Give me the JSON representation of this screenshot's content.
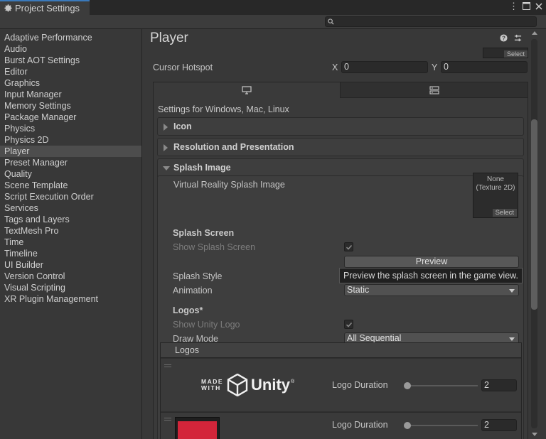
{
  "window": {
    "tab_title": "Project Settings",
    "buttons": [
      "more-options",
      "maximize",
      "close"
    ]
  },
  "search": {
    "placeholder": "",
    "value": ""
  },
  "sidebar": {
    "items": [
      {
        "label": "Adaptive Performance"
      },
      {
        "label": "Audio"
      },
      {
        "label": "Burst AOT Settings"
      },
      {
        "label": "Editor"
      },
      {
        "label": "Graphics"
      },
      {
        "label": "Input Manager"
      },
      {
        "label": "Memory Settings"
      },
      {
        "label": "Package Manager"
      },
      {
        "label": "Physics"
      },
      {
        "label": "Physics 2D"
      },
      {
        "label": "Player",
        "active": true
      },
      {
        "label": "Preset Manager"
      },
      {
        "label": "Quality"
      },
      {
        "label": "Scene Template"
      },
      {
        "label": "Script Execution Order"
      },
      {
        "label": "Services"
      },
      {
        "label": "Tags and Layers"
      },
      {
        "label": "TextMesh Pro"
      },
      {
        "label": "Time"
      },
      {
        "label": "Timeline"
      },
      {
        "label": "UI Builder"
      },
      {
        "label": "Version Control"
      },
      {
        "label": "Visual Scripting"
      },
      {
        "label": "XR Plugin Management"
      }
    ]
  },
  "main": {
    "title": "Player",
    "header_icons": [
      "help-icon",
      "preset-icon",
      "kebab-menu-icon"
    ],
    "cursor_select_label": "Select",
    "cursor_hotspot": {
      "label": "Cursor Hotspot",
      "x_label": "X",
      "x_value": "0",
      "y_label": "Y",
      "y_value": "0"
    },
    "platform_tabs": [
      "desktop-icon",
      "server-icon"
    ],
    "settings_for": "Settings for Windows, Mac, Linux",
    "sections": {
      "icon": "Icon",
      "resolution": "Resolution and Presentation",
      "splash": "Splash Image"
    },
    "splash": {
      "vr_label": "Virtual Reality Splash Image",
      "vr_texture_line1": "None",
      "vr_texture_line2": "(Texture 2D)",
      "vr_select": "Select",
      "splash_screen_heading": "Splash Screen",
      "show_splash_label": "Show Splash Screen",
      "show_splash_checked": true,
      "preview_button": "Preview",
      "tooltip": "Preview the splash screen in the game view.",
      "splash_style_label": "Splash Style",
      "animation_label": "Animation",
      "animation_value": "Static",
      "logos_heading": "Logos*",
      "show_unity_logo_label": "Show Unity Logo",
      "show_unity_logo_checked": true,
      "draw_mode_label": "Draw Mode",
      "draw_mode_value": "All Sequential",
      "logos_list_header": "Logos",
      "logo_rows": [
        {
          "made_with": "MADE\nWITH",
          "brand": "Unity",
          "duration_label": "Logo Duration",
          "duration_value": "2",
          "slider_level": 0
        },
        {
          "duration_label": "Logo Duration",
          "duration_value": "2",
          "slider_level": 0
        }
      ]
    }
  },
  "colors": {
    "accent_tab": "#3a79bb",
    "background": "#383838",
    "pink_logo": "#d3253a"
  }
}
